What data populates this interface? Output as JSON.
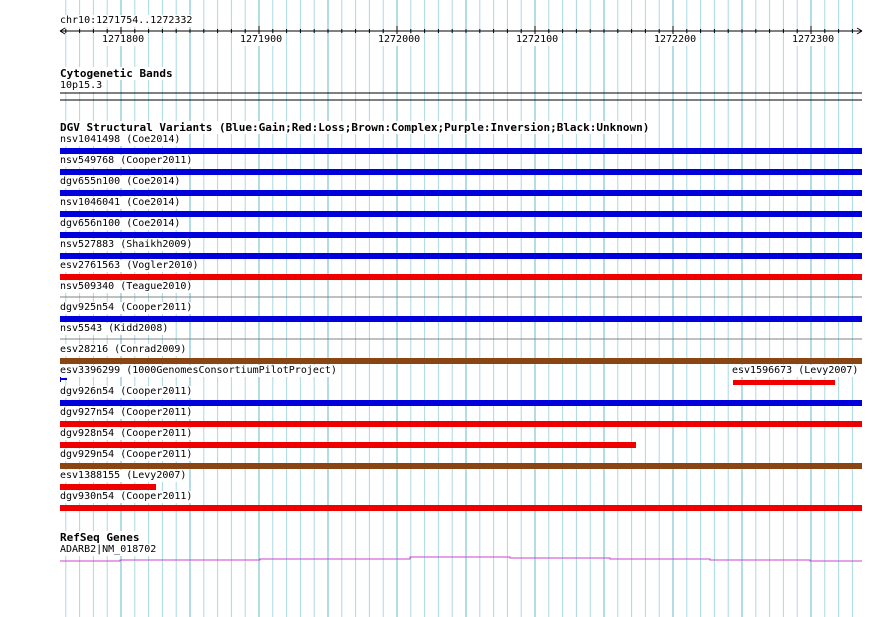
{
  "ruler": {
    "location": "chr10:1271754..1272332",
    "start": 1271754,
    "end": 1272332,
    "tick_labels": [
      "1271800",
      "1271900",
      "1272000",
      "1272100",
      "1272200",
      "1272300"
    ]
  },
  "cytoband": {
    "title": "Cytogenetic Bands",
    "band": "10p15.3"
  },
  "dgv": {
    "title": "DGV Structural Variants (Blue:Gain;Red:Loss;Brown:Complex;Purple:Inversion;Black:Unknown)",
    "colors": {
      "gain": "#0000dd",
      "loss": "#ee0000",
      "complex": "#8b4513",
      "gray": "#808080"
    },
    "rows": [
      {
        "label": "nsv1041498 (Coe2014)",
        "type": "gain"
      },
      {
        "label": "nsv549768 (Cooper2011)",
        "type": "gain"
      },
      {
        "label": "dgv655n100 (Coe2014)",
        "type": "gain"
      },
      {
        "label": "nsv1046041 (Coe2014)",
        "type": "gain"
      },
      {
        "label": "dgv656n100 (Coe2014)",
        "type": "gain"
      },
      {
        "label": "nsv527883 (Shaikh2009)",
        "type": "gain"
      },
      {
        "label": "esv2761563 (Vogler2010)",
        "type": "loss"
      },
      {
        "label": "nsv509340 (Teague2010)",
        "type": "gray"
      },
      {
        "label": "dgv925n54 (Cooper2011)",
        "type": "gain"
      },
      {
        "label": "nsv5543 (Kidd2008)",
        "type": "gray"
      },
      {
        "label": "esv28216 (Conrad2009)",
        "type": "complex"
      },
      {
        "label": "esv3396299 (1000GenomesConsortiumPilotProject)",
        "type": "gain",
        "short": true,
        "second": {
          "label": "esv1596673 (Levy2007)",
          "type": "loss"
        }
      },
      {
        "label": "dgv926n54 (Cooper2011)",
        "type": "gain"
      },
      {
        "label": "dgv927n54 (Cooper2011)",
        "type": "loss"
      },
      {
        "label": "dgv928n54 (Cooper2011)",
        "type": "loss",
        "partial": true
      },
      {
        "label": "dgv929n54 (Cooper2011)",
        "type": "complex"
      },
      {
        "label": "esv1388155 (Levy2007)",
        "type": "loss",
        "partial": true
      },
      {
        "label": "dgv930n54 (Cooper2011)",
        "type": "loss"
      }
    ]
  },
  "refseq": {
    "title": "RefSeq Genes",
    "gene": "ADARB2|NM_018702",
    "color": "#cc44cc"
  }
}
